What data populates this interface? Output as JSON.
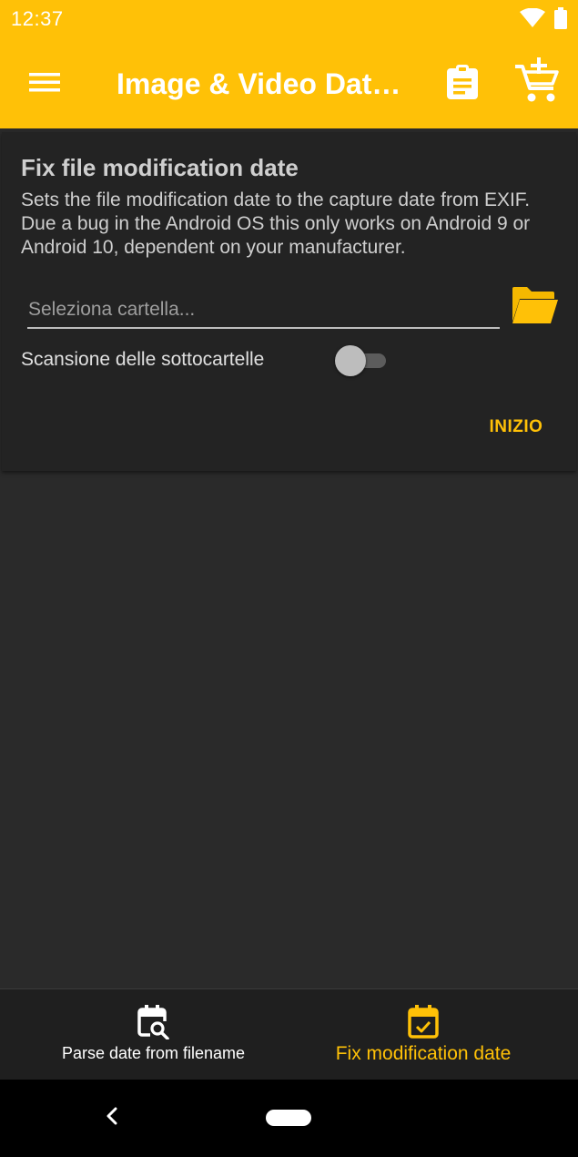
{
  "status_bar": {
    "time": "12:37",
    "icons": [
      "wifi-icon",
      "battery-icon"
    ]
  },
  "app_bar": {
    "title": "Image & Video Date Fixer",
    "menu_icon": "menu-icon",
    "actions": [
      "clipboard-icon",
      "add-to-cart-icon"
    ],
    "color": "#ffc107"
  },
  "card": {
    "title": "Fix file modification date",
    "description": "Sets the file modification date to the capture date from EXIF. Due a bug in the Android OS this only works on Android 9 or Android 10, dependent on your manufacturer.",
    "folder_input": {
      "value": "",
      "placeholder": "Seleziona cartella..."
    },
    "folder_icon": "folder-open-icon",
    "subfolder_label": "Scansione delle sottocartelle",
    "subfolder_toggle_on": false,
    "start_label": "INIZIO"
  },
  "bottom_nav": {
    "items": [
      {
        "label": "Parse date from filename",
        "icon": "calendar-search-icon",
        "active": false
      },
      {
        "label": "Fix modification date",
        "icon": "calendar-check-icon",
        "active": true
      }
    ],
    "active_color": "#ffc107"
  },
  "system_nav": {
    "back_icon": "back-chevron-icon",
    "home_icon": "home-pill"
  }
}
